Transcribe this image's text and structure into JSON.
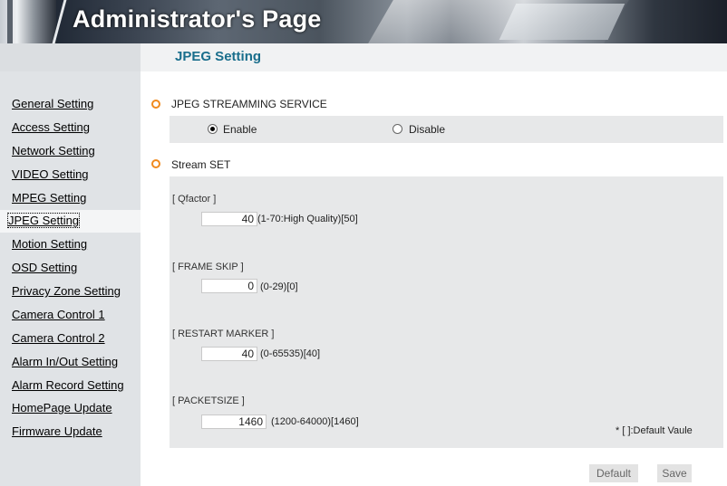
{
  "header": {
    "title": "Administrator's Page"
  },
  "sidebar": {
    "items": [
      {
        "label": "General Setting",
        "active": false
      },
      {
        "label": "Access Setting",
        "active": false
      },
      {
        "label": "Network Setting",
        "active": false
      },
      {
        "label": "VIDEO Setting",
        "active": false
      },
      {
        "label": "MPEG Setting",
        "active": false
      },
      {
        "label": "JPEG Setting",
        "active": true
      },
      {
        "label": "Motion Setting",
        "active": false
      },
      {
        "label": "OSD Setting",
        "active": false
      },
      {
        "label": "Privacy Zone Setting",
        "active": false
      },
      {
        "label": "Camera Control 1",
        "active": false
      },
      {
        "label": "Camera Control 2",
        "active": false
      },
      {
        "label": "Alarm In/Out Setting",
        "active": false
      },
      {
        "label": "Alarm Record Setting",
        "active": false
      },
      {
        "label": "HomePage Update",
        "active": false
      },
      {
        "label": "Firmware Update",
        "active": false
      }
    ]
  },
  "main": {
    "page_title": "JPEG Setting",
    "streaming_section": {
      "label": "JPEG STREAMMING SERVICE",
      "enable_label": "Enable",
      "disable_label": "Disable",
      "selected": "Enable"
    },
    "stream_set": {
      "label": "Stream SET",
      "qfactor": {
        "label": "[ Qfactor ]",
        "value": "40",
        "hint": "(1-70:High Quality)[50]"
      },
      "frame_skip": {
        "label": "[ FRAME SKIP ]",
        "value": "0",
        "hint": "(0-29)[0]"
      },
      "restart_marker": {
        "label": "[ RESTART MARKER ]",
        "value": "40",
        "hint": "(0-65535)[40]"
      },
      "packetsize": {
        "label": "[ PACKETSIZE ]",
        "value": "1460",
        "hint": "(1200-64000)[1460]"
      },
      "default_note": "* [ ]:Default Vaule"
    },
    "buttons": {
      "default_label": "Default",
      "save_label": "Save"
    }
  },
  "colors": {
    "accent_title": "#1a6e8c",
    "bullet": "#f08a1e",
    "panel": "#e7e8e9",
    "sidebar": "#e0e3e6"
  }
}
